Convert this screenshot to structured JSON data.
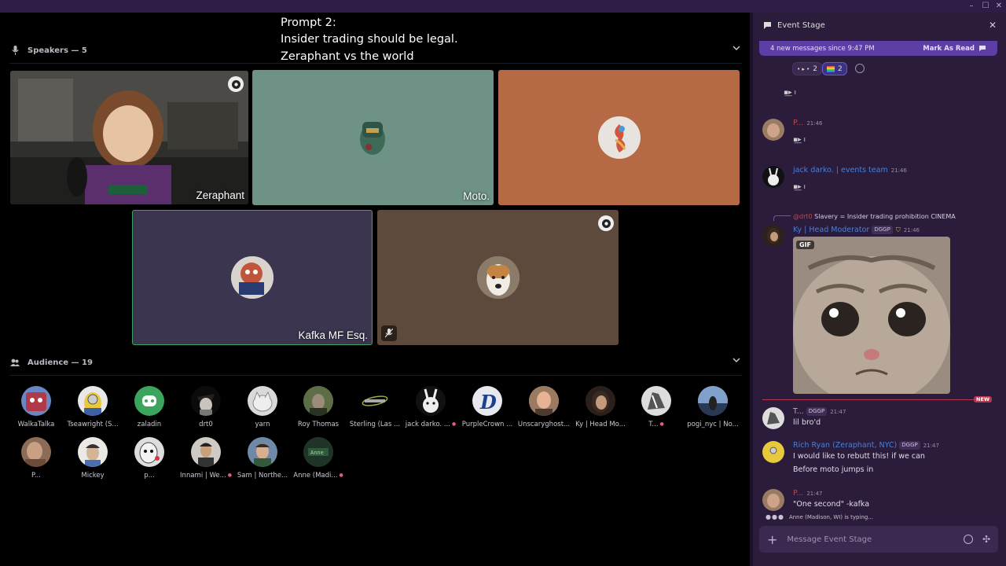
{
  "stage": {
    "caption_lines": [
      "Prompt 2:",
      "Insider trading should be legal.",
      "Zeraphant vs the world"
    ],
    "speakers_header": "Speakers — 5",
    "audience_header": "Audience — 19",
    "speakers": [
      {
        "name": "Zeraphant",
        "bg": "#3a3a3a"
      },
      {
        "name": "Moto.",
        "bg": "#6e9386"
      },
      {
        "name": "",
        "bg": "#b56a45"
      },
      {
        "name": "Kafka MF Esq.",
        "bg": "#3b3550",
        "speaking": true
      },
      {
        "name": "",
        "bg": "#5e4a3c"
      }
    ],
    "audience": [
      {
        "name": "WalkaTalka"
      },
      {
        "name": "Tseawright (S..."
      },
      {
        "name": "zaladin"
      },
      {
        "name": "drt0"
      },
      {
        "name": "yarn"
      },
      {
        "name": "Roy Thomas"
      },
      {
        "name": "Sterling (Las ..."
      },
      {
        "name": "jack darko. ...",
        "dot": true
      },
      {
        "name": "PurpleCrown ..."
      },
      {
        "name": "Unscaryghost..."
      },
      {
        "name": "Ky | Head Mo..."
      },
      {
        "name": "T...",
        "dot": true
      },
      {
        "name": "pogi_nyc | No..."
      },
      {
        "name": "P..."
      },
      {
        "name": "Mickey"
      },
      {
        "name": "p..."
      },
      {
        "name": "Innami | We...",
        "dot": true
      },
      {
        "name": "Sam | Northe..."
      },
      {
        "name": "Anne (Madi...",
        "dot": true
      }
    ]
  },
  "chat": {
    "title": "Event Stage",
    "new_messages": "4 new messages since 9:47 PM",
    "mark_as_read": "Mark As Read",
    "reactions": [
      "2",
      "2"
    ],
    "messages": [
      {
        "author": "P...",
        "time": "21:46"
      },
      {
        "author": "jack darko. | events team",
        "time": "21:46"
      },
      {
        "reply_to": "@drt0",
        "reply_text": "Slavery = Insider trading prohibition CINEMA",
        "author": "Ky | Head Moderator",
        "tag": "DGGP",
        "time": "21:46",
        "gif_label": "GIF"
      },
      {
        "author": "T...",
        "tag": "DGGP",
        "time": "21:47",
        "text": [
          "lil bro'd"
        ]
      },
      {
        "author": "Rich Ryan (Zeraphant, NYC)",
        "tag": "DGGP",
        "time": "21:47",
        "text": [
          "I would like to rebutt this! if we can",
          "Before moto jumps in"
        ]
      },
      {
        "author": "P...",
        "time": "21:47",
        "text": [
          "\"One second\" -kafka"
        ]
      }
    ],
    "new_label": "NEW",
    "typing": "Anne (Madison, WI) is typing...",
    "placeholder": "Message Event Stage"
  },
  "colors": {
    "chat_bg": "#2a1c3a",
    "accent": "#5d3ea5",
    "speaking_ring": "#3ba55d",
    "new_line": "#b5384c"
  }
}
